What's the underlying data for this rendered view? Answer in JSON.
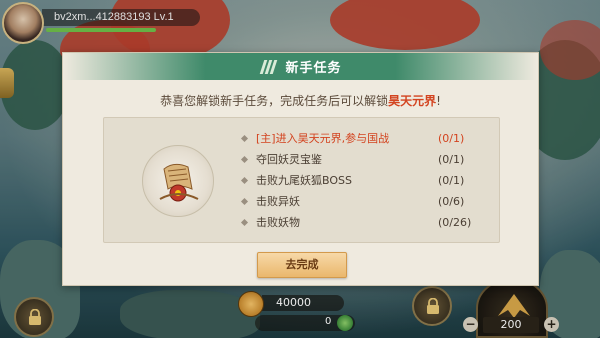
{
  "player": {
    "name_level": "bv2xm...412883193  Lv.1"
  },
  "dialog": {
    "title": "新手任务",
    "intro_prefix": "恭喜您解锁新手任务，完成任务后可以解锁",
    "intro_highlight": "昊天元界",
    "intro_suffix": "!",
    "tasks": [
      {
        "name": "[主]进入昊天元界,参与国战",
        "progress": "(0/1)"
      },
      {
        "name": "夺回妖灵宝鉴",
        "progress": "(0/1)"
      },
      {
        "name": "击败九尾妖狐BOSS",
        "progress": "(0/1)"
      },
      {
        "name": "击败异妖",
        "progress": "(0/6)"
      },
      {
        "name": "击败妖物",
        "progress": "(0/26)"
      }
    ],
    "complete_button": "去完成"
  },
  "hud": {
    "gold": "40000",
    "jade": "0",
    "level_value": "200",
    "minus_label": "−",
    "plus_label": "+"
  },
  "colors": {
    "accent_green": "#3f8a6a",
    "highlight_red": "#d3431f",
    "dialog_bg": "#efeadf",
    "button_gold": "#eab76c"
  }
}
